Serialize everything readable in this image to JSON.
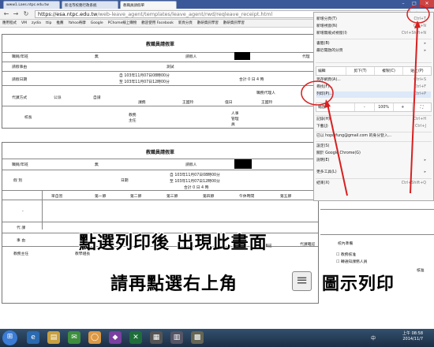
{
  "browser": {
    "tabs": [
      {
        "label": "www1.Laes.ntpc.edu.tw"
      },
      {
        "label": "新北市校務行政系統"
      },
      {
        "label": "教職員請假單",
        "active": true
      }
    ],
    "url_host": "https://esa.ntpc.edu.tw",
    "url_path": "/web-leave_agent/templates/leave_agent/rwd/reqleave_receipt.html",
    "bookmarks": [
      "應用程式",
      "VM",
      "zydia",
      "ttip",
      "推薦",
      "Yahoo奇摩",
      "Google",
      "PChome線上購物",
      "歡迎使用 Facebook",
      "新頁分頁",
      "數研資訊學習",
      "數研資訊學習"
    ]
  },
  "form1": {
    "title": "教職員請假單",
    "label_year": "職稱/年班",
    "val_year": "無",
    "label_applicant": "請假人",
    "label_agent": "代理",
    "label_reason": "請假事由",
    "val_reason": "測試",
    "label_date": "請假日期",
    "date_from": "自  103年11月07日08時00分",
    "date_to": "至  103年11月07日12時00分",
    "total": "合計 0 日 4 時",
    "label_method": "代課方式",
    "val_public": "公派",
    "val_self": "自請",
    "col_subject": "課務",
    "col_wang1": "王國玲",
    "col_duty": "值日",
    "col_wang2": "王國玲",
    "col_admin": "職務代理人",
    "label_principal": "校長",
    "label_academic": "教務主任",
    "label_hr": "人事管理員"
  },
  "form2": {
    "title": "教職員請假單",
    "label_year": "職稱/年班",
    "val_year": "無",
    "label_applicant": "請假人",
    "label_type": "假  別",
    "label_date": "日期",
    "date_from": "自  103年11月07日08時00分",
    "date_to": "至  103年11月07日12時00分",
    "total": "合計 0 日 4 時",
    "periods": [
      "早自習",
      "第一節",
      "第二節",
      "第三節",
      "第四節",
      "午休時間",
      "第五節",
      "第六節",
      "第七節"
    ],
    "label_dash": "-",
    "label_agent": "代  課",
    "label_matter": "事  由",
    "label_academic": "教務主任",
    "label_leader": "教學組長",
    "label_agent_confirm": "代課確認",
    "label_school_system": "校內準備",
    "label_approve": "核准",
    "label_remark": "備註",
    "check1": "教務核准",
    "check2": "轉通知課務人員"
  },
  "menu": {
    "items_top": [
      {
        "label": "新增分頁(T)",
        "shortcut": "Ctrl+T"
      },
      {
        "label": "新增視窗(N)",
        "shortcut": "Ctrl+N"
      },
      {
        "label": "新增無痕式視窗(I)",
        "shortcut": "Ctrl+Shift+N"
      },
      {
        "label": "書籤(B)",
        "shortcut": "▸"
      },
      {
        "label": "最近開啟的分頁",
        "shortcut": "▸"
      }
    ],
    "edit_row": {
      "label": "編輯",
      "cut": "剪下(T)",
      "copy": "複製(C)",
      "paste": "貼上(P)"
    },
    "items_mid": [
      {
        "label": "另存網頁(A)...",
        "shortcut": "Ctrl+S"
      },
      {
        "label": "尋找(F)...",
        "shortcut": "Ctrl+F"
      },
      {
        "label": "列印(P)...",
        "shortcut": "Ctrl+P"
      }
    ],
    "zoom_row": {
      "label": "縮放",
      "minus": "-",
      "value": "100%",
      "plus": "+"
    },
    "items_bottom": [
      {
        "label": "記錄(H)",
        "shortcut": "Ctrl+H"
      },
      {
        "label": "下載(J)",
        "shortcut": "Ctrl+J"
      },
      {
        "label": "已以 hopoifung@gmail.com 的身分登入...",
        "shortcut": ""
      },
      {
        "label": "設定(S)",
        "shortcut": ""
      },
      {
        "label": "關於 Google Chrome(G)",
        "shortcut": ""
      },
      {
        "label": "說明(E)",
        "shortcut": "▸"
      },
      {
        "label": "更多工具(L)",
        "shortcut": "▸"
      },
      {
        "label": "結束(X)",
        "shortcut": "Ctrl+Shift+Q"
      }
    ]
  },
  "captions": {
    "line1": "點選列印後 出現此畫面",
    "line2a": "請再點選右上角",
    "line2b": "圖示列印",
    "menu_icon": "≡"
  },
  "taskbar": {
    "icons": [
      "◉",
      "e",
      "▤",
      "✉",
      "◯",
      "◆",
      "✕",
      "▦",
      "▥",
      "▩"
    ],
    "time": "上午 08:58",
    "date": "2014/11/7",
    "lang": "中"
  },
  "colors": {
    "annotation": "#d82020",
    "tabstrip": "#3b5998"
  }
}
